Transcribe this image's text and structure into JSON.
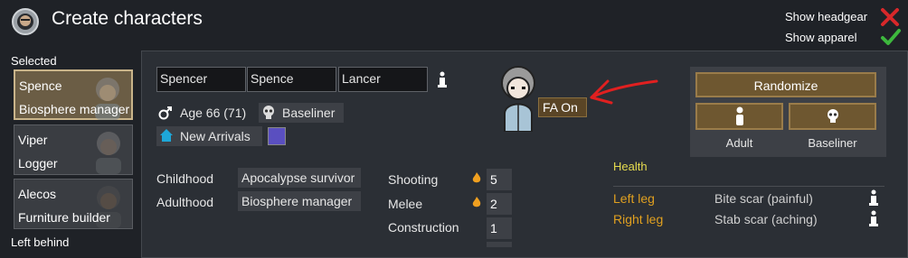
{
  "header": {
    "title": "Create characters",
    "show_headgear": "Show headgear",
    "show_apparel": "Show apparel"
  },
  "sidebar": {
    "selected_label": "Selected",
    "left_behind_label": "Left behind",
    "pawns": [
      {
        "name": "Spence",
        "role": "Biosphere manager",
        "selected": true
      },
      {
        "name": "Viper",
        "role": "Logger",
        "selected": false
      },
      {
        "name": "Alecos",
        "role": "Furniture builder",
        "selected": false
      }
    ]
  },
  "character": {
    "first_name": "Spencer",
    "nick_name": "Spence",
    "last_name": "Lancer",
    "age": "Age 66 (71)",
    "xenotype": "Baseliner",
    "faction": "New Arrivals",
    "favorite_color": "#5a4fc0",
    "childhood_label": "Childhood",
    "childhood_value": "Apocalypse survivor",
    "adulthood_label": "Adulthood",
    "adulthood_value": "Biosphere manager"
  },
  "skills": [
    {
      "name": "Shooting",
      "value": "5",
      "passion": true
    },
    {
      "name": "Melee",
      "value": "2",
      "passion": true
    },
    {
      "name": "Construction",
      "value": "1",
      "passion": false
    }
  ],
  "fa_button": "FA On",
  "generator": {
    "randomize": "Randomize",
    "dev_stage": "Adult",
    "xenotype": "Baseliner"
  },
  "health": {
    "title": "Health",
    "entries": [
      {
        "part": "Left leg",
        "condition": "Bite scar (painful)"
      },
      {
        "part": "Right leg",
        "condition": "Stab scar (aching)"
      }
    ]
  },
  "colors": {
    "accent_gold": "#e0a020",
    "health_title": "#e6dc4f",
    "close_red": "#d8282a",
    "check_green": "#3db83d",
    "annotation_arrow": "#e02020"
  }
}
